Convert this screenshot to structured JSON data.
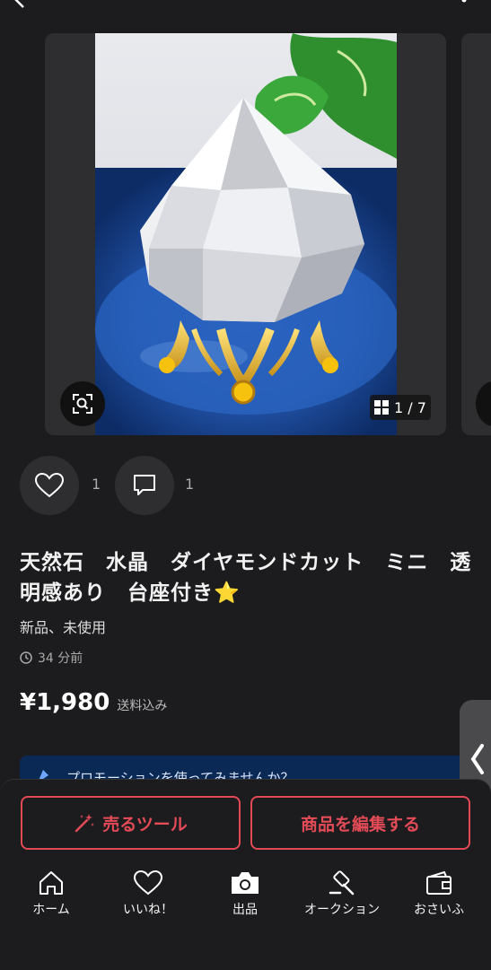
{
  "gallery": {
    "counter": "1 / 7"
  },
  "actions": {
    "like_count": "1",
    "comment_count": "1"
  },
  "item": {
    "title": "天然石　水晶　ダイヤモンドカット　ミニ　透明感あり　台座付き⭐️",
    "condition": "新品、未使用",
    "posted": "34 分前",
    "price": "¥1,980",
    "price_note": "送料込み"
  },
  "promo": {
    "text": "プロモーションを使ってみませんか？"
  },
  "sheet": {
    "sell_tools_label": "売るツール",
    "edit_label": "商品を編集する"
  },
  "nav": {
    "items": [
      {
        "label": "ホーム",
        "icon": "home-icon"
      },
      {
        "label": "いいね！",
        "icon": "heart-icon"
      },
      {
        "label": "出品",
        "icon": "camera-icon"
      },
      {
        "label": "オークション",
        "icon": "gavel-icon"
      },
      {
        "label": "おさいふ",
        "icon": "wallet-icon"
      }
    ]
  },
  "colors": {
    "accent": "#e34b57",
    "background": "#1c1c1e",
    "card": "#2e2e30",
    "promo": "#0a2a55"
  }
}
